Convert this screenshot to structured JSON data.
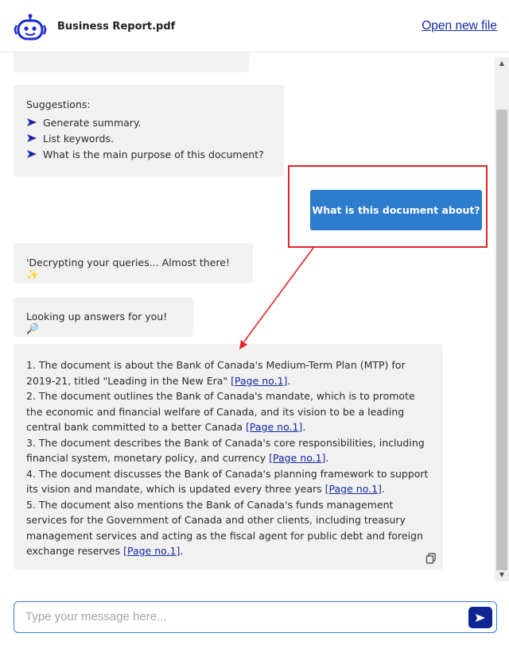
{
  "header": {
    "file_name": "Business Report.pdf",
    "open_link": "Open new file"
  },
  "icons": {
    "logo": "robot-face-icon",
    "suggestion": "send-arrow-icon",
    "copy": "copy-icon",
    "send": "send-icon"
  },
  "suggestions": {
    "title": "Suggestions:",
    "items": [
      "Generate summary.",
      "List keywords.",
      "What is the main purpose of this document?"
    ]
  },
  "user_message": "What is this document about?",
  "status": {
    "thinking": "'Decrypting your queries... Almost there! ✨",
    "lookup": "Looking up answers for you! 🔎"
  },
  "answer": {
    "page_link": "[Page no.1]",
    "points": [
      "1. The document is about the Bank of Canada's Medium-Term Plan (MTP) for 2019-21, titled \"Leading in the New Era\"",
      "2. The document outlines the Bank of Canada's mandate, which is to promote the economic and financial welfare of Canada, and its vision to be a leading central bank committed to a better Canada",
      "3. The document describes the Bank of Canada's core responsibilities, including financial system, monetary policy, and currency",
      "4. The document discusses the Bank of Canada's planning framework to support its vision and mandate, which is updated every three years",
      "5. The document also mentions the Bank of Canada's funds management services for the Government of Canada and other clients, including treasury management services and acting as the fiscal agent for public debt and foreign exchange reserves"
    ]
  },
  "input": {
    "placeholder": "Type your message here..."
  },
  "colors": {
    "accent": "#2d7ccd",
    "link": "#1428a0",
    "send_button": "#0f2594",
    "bubble": "#f1f1f2",
    "annotation": "#e3232c"
  }
}
